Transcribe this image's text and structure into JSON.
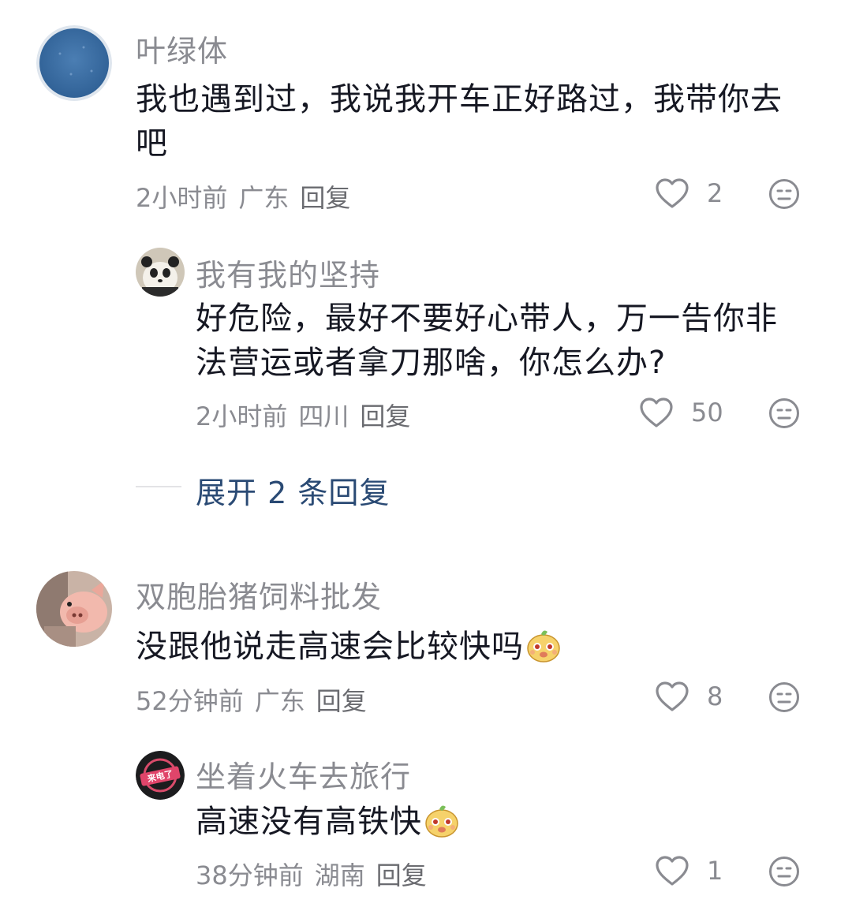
{
  "comments": [
    {
      "user": "叶绿体",
      "content": "我也遇到过，我说我开车正好路过，我带你去吧",
      "time": "2小时前",
      "location": "广东",
      "reply_label": "回复",
      "likes": "2",
      "replies": [
        {
          "user": "我有我的坚持",
          "content": "好危险，最好不要好心带人，万一告你非法营运或者拿刀那啥，你怎么办?",
          "time": "2小时前",
          "location": "四川",
          "reply_label": "回复",
          "likes": "50"
        }
      ],
      "expand_label": "展开 2 条回复"
    },
    {
      "user": "双胞胎猪饲料批发",
      "content": "没跟他说走高速会比较快吗",
      "time": "52分钟前",
      "location": "广东",
      "reply_label": "回复",
      "likes": "8",
      "replies": [
        {
          "user": "坐着火车去旅行",
          "content": "高速没有高铁快",
          "time": "38分钟前",
          "location": "湖南",
          "reply_label": "回复",
          "likes": "1",
          "avatar_text": "来电了"
        }
      ]
    }
  ],
  "icons": {
    "like": "heart-outline-icon",
    "dislike": "neutral-face-icon",
    "sticker": "sticker-emoji-icon"
  },
  "colors": {
    "username": "#8a8b91",
    "text": "#161823",
    "expand": "#2a4a74"
  }
}
